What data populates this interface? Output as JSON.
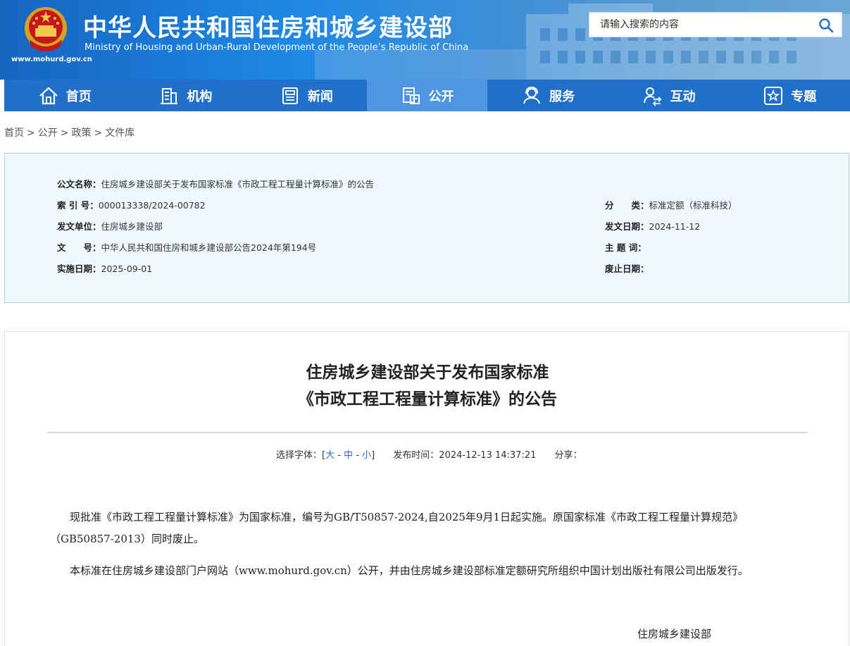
{
  "header": {
    "title_cn": "中华人民共和国住房和城乡建设部",
    "title_en": "Ministry of Housing and Urban-Rural Development of the People’s Republic of China",
    "site_url": "www.mohurd.gov.cn",
    "search_placeholder": "请输入搜索的内容",
    "colors": {
      "banner": "#1e88e5",
      "nav": "#1f6fcb",
      "nav_active": "#4e95e3"
    }
  },
  "nav": {
    "items": [
      {
        "label": "首页",
        "icon": "home-icon"
      },
      {
        "label": "机构",
        "icon": "building-icon"
      },
      {
        "label": "新闻",
        "icon": "news-icon"
      },
      {
        "label": "公开",
        "icon": "disclosure-icon",
        "active": true
      },
      {
        "label": "服务",
        "icon": "service-icon"
      },
      {
        "label": "互动",
        "icon": "interact-icon"
      },
      {
        "label": "专题",
        "icon": "topic-star-icon"
      }
    ]
  },
  "breadcrumb": {
    "items": [
      "首页",
      "公开",
      "政策",
      "文件库"
    ],
    "separator": ">"
  },
  "meta": {
    "doc_name_label": "公文名称：",
    "doc_name_value": "住房城乡建设部关于发布国家标准《市政工程工程量计算标准》的公告",
    "index_label": "索 引 号：",
    "index_value": "000013338/2024-00782",
    "issuer_label": "发文单位：",
    "issuer_value": "住房城乡建设部",
    "docno_label": "文　　号：",
    "docno_value": "中华人民共和国住房和城乡建设部公告2024年第194号",
    "impl_label": "实施日期：",
    "impl_value": "2025-09-01",
    "category_label": "分　　类：",
    "category_value": "标准定额（标准科技）",
    "issue_date_label": "发文日期：",
    "issue_date_value": "2024-11-12",
    "keywords_label": "主 题 词：",
    "keywords_value": "",
    "abolish_label": "废止日期：",
    "abolish_value": ""
  },
  "article": {
    "title_line1": "住房城乡建设部关于发布国家标准",
    "title_line2": "《市政工程工程量计算标准》的公告",
    "font_label": "选择字体：[",
    "font_large": "大",
    "font_medium": "中",
    "font_small": "小",
    "font_close": "]",
    "publish_label": "发布时间：",
    "publish_time": "2024-12-13 14:37:21",
    "share_label": "分享：",
    "para1_line1": "现批准《市政工程工程量计算标准》为国家标准，编号为GB/T50857-2024,自2025年9月1日起实施。原国家标准《市政工程工程量计算规范》",
    "para1_line2": "（GB50857-2013）同时废止。",
    "para2": "本标准在住房城乡建设部门户网站（www.mohurd.gov.cn）公开，并由住房城乡建设部标准定额研究所组织中国计划出版社有限公司出版发行。",
    "signature": "住房城乡建设部"
  }
}
